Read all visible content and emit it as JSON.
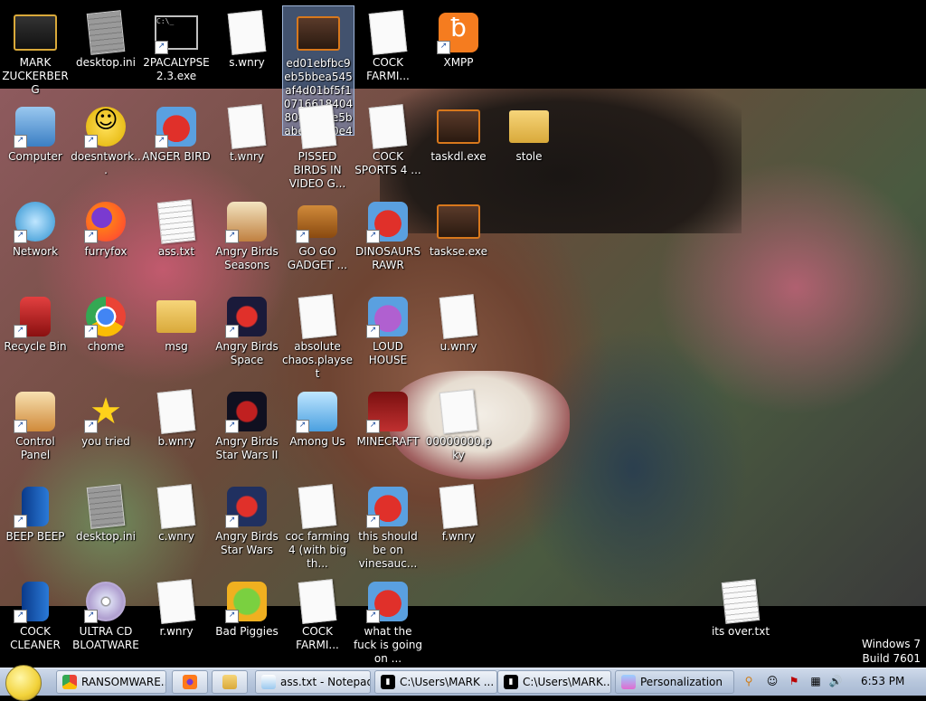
{
  "desktop": {
    "icons": [
      {
        "label": "MARK ZUCKERBERG",
        "icon": "user-folder-icon"
      },
      {
        "label": "desktop.ini",
        "icon": "settings-file-icon"
      },
      {
        "label": "2PACALYPSE 2.3.exe",
        "icon": "cmd-icon"
      },
      {
        "label": "s.wnry",
        "icon": "blank-file-icon"
      },
      {
        "label": "ed01ebfbc9eb5bbea545af4d01bf5f1071661840480439c6e5babe8e080e41aa.exe",
        "icon": "exe-icon"
      },
      {
        "label": "COCK FARMI...",
        "icon": "blank-file-icon"
      },
      {
        "label": "XMPP",
        "icon": "xampp-icon"
      },
      {
        "label": "Computer",
        "icon": "computer-icon"
      },
      {
        "label": "doesntwork...",
        "icon": "yahoo-messenger-icon"
      },
      {
        "label": "ANGER BIRD",
        "icon": "angry-bird-icon"
      },
      {
        "label": "t.wnry",
        "icon": "blank-file-icon"
      },
      {
        "label": "PISSED BIRDS IN VIDEO G...",
        "icon": "blank-file-icon"
      },
      {
        "label": "COCK SPORTS 4 ...",
        "icon": "blank-file-icon"
      },
      {
        "label": "taskdl.exe",
        "icon": "exe-icon"
      },
      {
        "label": "stole",
        "icon": "folder-icon"
      },
      {
        "label": "Network",
        "icon": "network-icon"
      },
      {
        "label": "furryfox",
        "icon": "firefox-icon"
      },
      {
        "label": "ass.txt",
        "icon": "text-file-icon"
      },
      {
        "label": "Angry Birds Seasons",
        "icon": "angry-birds-seasons-icon"
      },
      {
        "label": "GO GO GADGET ...",
        "icon": "briefcase-icon"
      },
      {
        "label": "DINOSAURS RAWR",
        "icon": "angry-bird-icon"
      },
      {
        "label": "taskse.exe",
        "icon": "exe-icon"
      },
      {
        "label": "Recycle Bin",
        "icon": "recycle-bin-icon"
      },
      {
        "label": "chome",
        "icon": "chrome-icon"
      },
      {
        "label": "msg",
        "icon": "folder-icon"
      },
      {
        "label": "Angry Birds Space",
        "icon": "angry-birds-space-icon"
      },
      {
        "label": "absolute chaos.playset",
        "icon": "blank-file-icon"
      },
      {
        "label": "LOUD HOUSE",
        "icon": "purple-bird-icon"
      },
      {
        "label": "u.wnry",
        "icon": "blank-file-icon"
      },
      {
        "label": "Control Panel",
        "icon": "control-panel-icon"
      },
      {
        "label": "you tried",
        "icon": "star-icon"
      },
      {
        "label": "b.wnry",
        "icon": "blank-file-icon"
      },
      {
        "label": "Angry Birds Star Wars II",
        "icon": "angry-birds-starwars2-icon"
      },
      {
        "label": "Among Us",
        "icon": "among-us-icon"
      },
      {
        "label": "MINECRAFT",
        "icon": "minecraft-icon"
      },
      {
        "label": "00000000.pky",
        "icon": "blank-file-icon"
      },
      {
        "label": "BEEP BEEP",
        "icon": "blue-book-icon"
      },
      {
        "label": "desktop.ini",
        "icon": "settings-file-icon"
      },
      {
        "label": "c.wnry",
        "icon": "blank-file-icon"
      },
      {
        "label": "Angry Birds Star Wars",
        "icon": "angry-birds-starwars-icon"
      },
      {
        "label": "coc farming 4 (with big th...",
        "icon": "blank-file-icon"
      },
      {
        "label": "this should be on vinesauc...",
        "icon": "angry-bird-icon"
      },
      {
        "label": "f.wnry",
        "icon": "blank-file-icon"
      },
      {
        "label": "COCK CLEANER",
        "icon": "blue-book-icon"
      },
      {
        "label": "ULTRA CD BLOATWARE",
        "icon": "cd-icon"
      },
      {
        "label": "r.wnry",
        "icon": "blank-file-icon"
      },
      {
        "label": "Bad Piggies",
        "icon": "bad-piggies-icon"
      },
      {
        "label": "COCK FARMI...",
        "icon": "blank-file-icon"
      },
      {
        "label": "what the fuck is going on ...",
        "icon": "angry-bird-icon"
      },
      {
        "label": "its over.txt",
        "icon": "text-file-icon"
      }
    ]
  },
  "watermark": {
    "line1": "Windows 7",
    "line2": "Build 7601"
  },
  "taskbar": {
    "tasks": [
      {
        "label": "RANSOMWARE...",
        "icon": "chrome-icon"
      },
      {
        "label": "",
        "icon": "firefox-icon"
      },
      {
        "label": "",
        "icon": "folder-icon"
      },
      {
        "label": "ass.txt - Notepad",
        "icon": "notepad-icon"
      },
      {
        "label": "C:\\Users\\MARK ...",
        "icon": "cmd-icon"
      },
      {
        "label": "C:\\Users\\MARK...",
        "icon": "cmd-icon"
      },
      {
        "label": "Personalization",
        "icon": "personalization-icon"
      }
    ],
    "clock": "6:53 PM"
  },
  "colors": {
    "taskbar": "#b7c6dc",
    "selection": "#7896c8",
    "exe_border": "#d8781c"
  }
}
